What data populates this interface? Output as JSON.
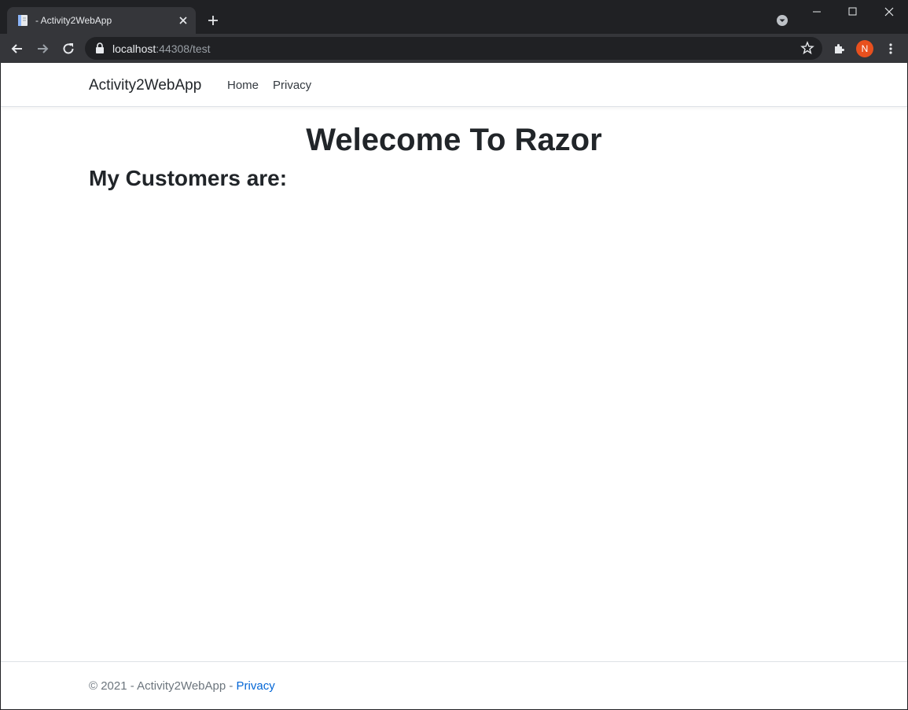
{
  "browser": {
    "tab_title": "- Activity2WebApp",
    "url_host": "localhost",
    "url_rest": ":44308/test",
    "profile_initial": "N",
    "profile_color": "#e8501e"
  },
  "site": {
    "brand": "Activity2WebApp",
    "nav": {
      "home": "Home",
      "privacy": "Privacy"
    }
  },
  "main": {
    "title": "Welecome To Razor",
    "subtitle": "My Customers are:"
  },
  "footer": {
    "text": "© 2021 - Activity2WebApp - ",
    "privacy_link": "Privacy",
    "link_color": "#0366d6"
  }
}
